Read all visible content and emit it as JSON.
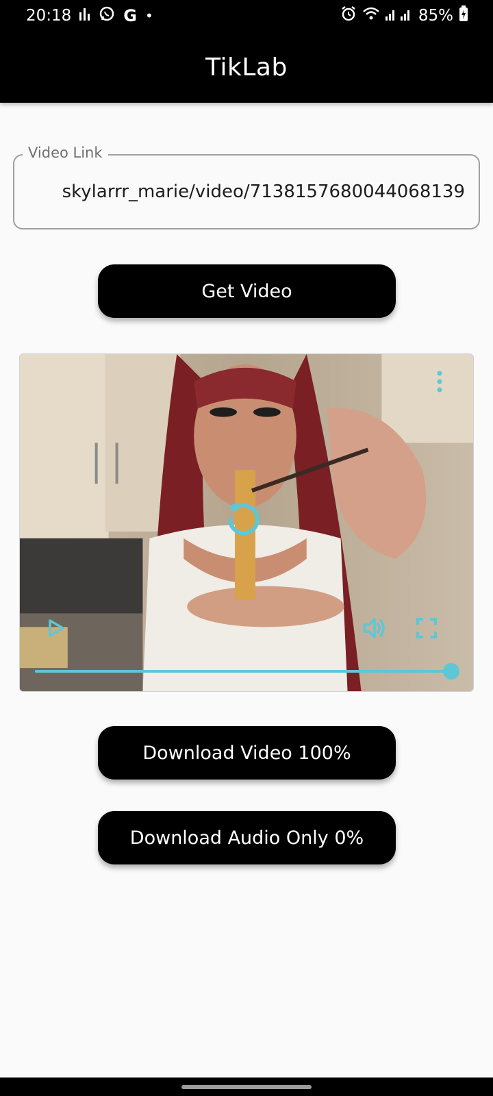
{
  "status_bar": {
    "time": "20:18",
    "battery": "85%",
    "icons": [
      "signal-bars-icon",
      "whatsapp-icon",
      "google-icon",
      "dot-icon",
      "alarm-icon",
      "wifi-icon",
      "cell-signal-icon",
      "battery-charging-icon"
    ]
  },
  "app_bar": {
    "title": "TikLab"
  },
  "video_link": {
    "label": "Video Link",
    "value": "skylarrr_marie/video/7138157680044068139"
  },
  "buttons": {
    "get_video": "Get Video",
    "download_video": "Download Video 100%",
    "download_audio": "Download Audio Only 0%"
  },
  "player": {
    "progress": 1.0,
    "accent_color": "#5fc6d4",
    "icons": [
      "more-vert-icon",
      "replay-icon",
      "play-icon",
      "volume-icon",
      "fullscreen-icon"
    ]
  },
  "colors": {
    "app_bar": "#000000",
    "background": "#fafafa",
    "button": "#000000",
    "accent": "#5fc6d4"
  }
}
